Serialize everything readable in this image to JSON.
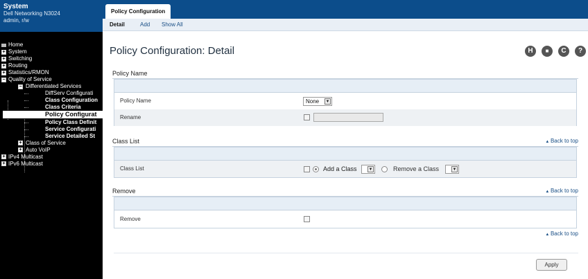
{
  "sidebar": {
    "system_title": "System",
    "device": "Dell Networking N3024",
    "user": "admin, r/w",
    "tree": {
      "home": "Home",
      "system": "System",
      "switching": "Switching",
      "routing": "Routing",
      "statistics": "Statistics/RMON",
      "qos": "Quality of Service",
      "diffserv": "Differentiated Services",
      "diffserv_config": "DiffServ Configurati",
      "class_config": "Class Configuration",
      "class_criteria": "Class Criteria",
      "policy_config": "Policy Configurat",
      "policy_class_def": "Policy Class Definit",
      "service_config": "Service Configurati",
      "service_detailed": "Service Detailed St",
      "class_of_service": "Class of Service",
      "auto_voip": "Auto VoIP",
      "ipv4_multicast": "IPv4 Multicast",
      "ipv6_multicast": "IPv6 Multicast"
    }
  },
  "header": {
    "tab": "Policy Configuration",
    "subtabs": [
      "Detail",
      "Add",
      "Show All"
    ]
  },
  "main": {
    "title": "Policy Configuration: Detail",
    "toolbar_icons": [
      "H",
      "■",
      "C",
      "?"
    ],
    "sections": {
      "policy_name": {
        "heading": "Policy Name",
        "row1_label": "Policy Name",
        "select_value": "None",
        "row2_label": "Rename"
      },
      "class_list": {
        "heading": "Class List",
        "back_to_top": "Back to top",
        "row_label": "Class List",
        "add_label": "Add a Class",
        "remove_label": "Remove a Class"
      },
      "remove": {
        "heading": "Remove",
        "back_to_top": "Back to top",
        "row_label": "Remove"
      }
    },
    "back_to_top_bottom": "Back to top",
    "apply_label": "Apply"
  },
  "colors": {
    "brand_blue": "#0c4d8b",
    "sidebar_bg": "#000000",
    "link": "#1a4f86"
  }
}
